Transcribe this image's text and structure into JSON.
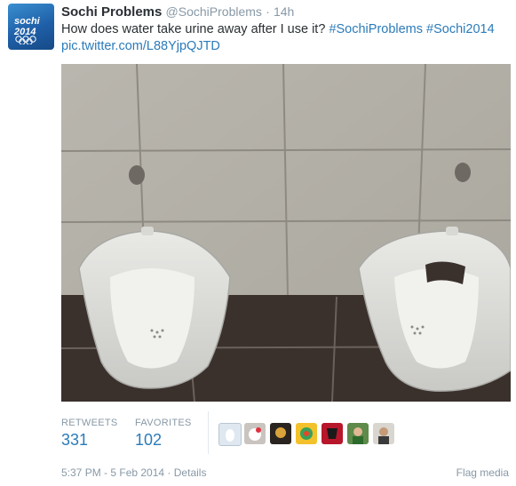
{
  "tweet": {
    "author_name": "Sochi Problems",
    "handle": "@SochiProblems",
    "separator": "·",
    "time_ago": "14h",
    "text": "How does water take urine away after I use it?",
    "hashtag1": "#SochiProblems",
    "hashtag2": "#Sochi2014",
    "link": "pic.twitter.com/L88YjpQJTD",
    "avatar_text_1": "sochi",
    "avatar_text_2": "2014"
  },
  "stats": {
    "retweets_label": "RETWEETS",
    "retweets_value": "331",
    "favorites_label": "FAVORITES",
    "favorites_value": "102"
  },
  "footer": {
    "timestamp": "5:37 PM - 5 Feb 2014",
    "separator": "·",
    "details_label": "Details",
    "flag_label": "Flag media"
  },
  "colors": {
    "link": "#2b7bb9",
    "muted": "#8899a6",
    "text": "#292f33"
  }
}
